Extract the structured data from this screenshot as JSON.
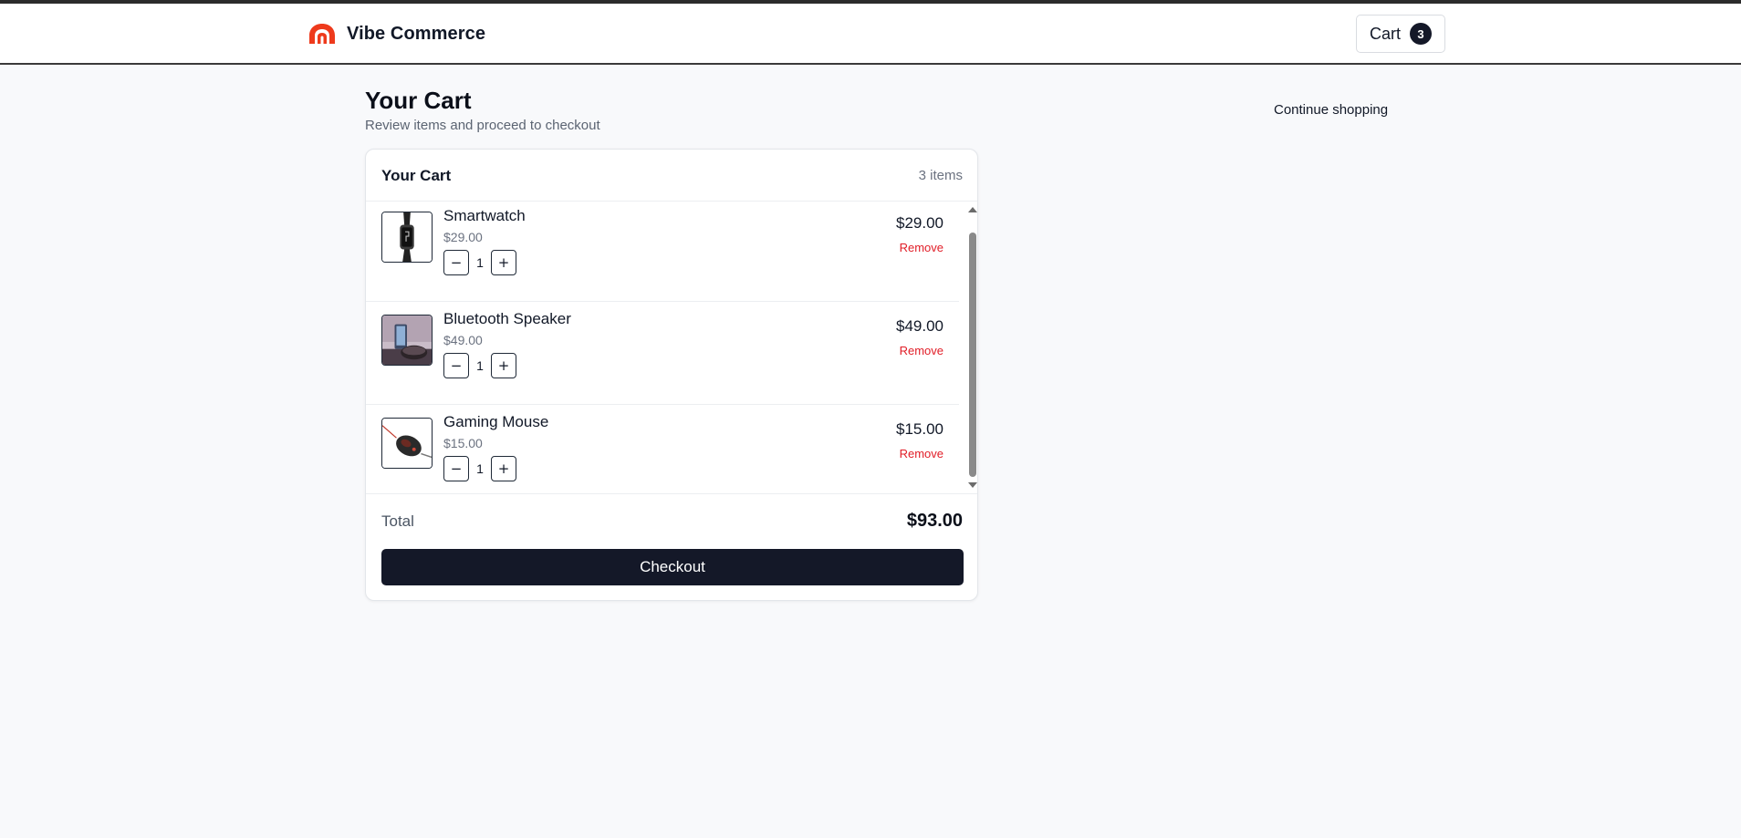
{
  "brand": {
    "name": "Vibe Commerce",
    "logo_icon": "vibe-logo-icon",
    "accent": "#ee3a1c"
  },
  "header": {
    "cart_label": "Cart",
    "cart_count": "3"
  },
  "page": {
    "title": "Your Cart",
    "subtitle": "Review items and proceed to checkout",
    "continue_label": "Continue shopping"
  },
  "cart": {
    "title": "Your Cart",
    "count_label": "3 items",
    "items": [
      {
        "name": "Smartwatch",
        "unit_price": "$29.00",
        "quantity": "1",
        "line_total": "$29.00",
        "remove_label": "Remove",
        "decrement": "−",
        "increment": "+"
      },
      {
        "name": "Bluetooth Speaker",
        "unit_price": "$49.00",
        "quantity": "1",
        "line_total": "$49.00",
        "remove_label": "Remove",
        "decrement": "−",
        "increment": "+"
      },
      {
        "name": "Gaming Mouse",
        "unit_price": "$15.00",
        "quantity": "1",
        "line_total": "$15.00",
        "remove_label": "Remove",
        "decrement": "−",
        "increment": "+"
      }
    ],
    "total_label": "Total",
    "total_value": "$93.00",
    "checkout_label": "Checkout"
  },
  "colors": {
    "primary": "#141828",
    "danger": "#e11d27",
    "muted": "#6b7280",
    "background": "#f8f9fb"
  }
}
